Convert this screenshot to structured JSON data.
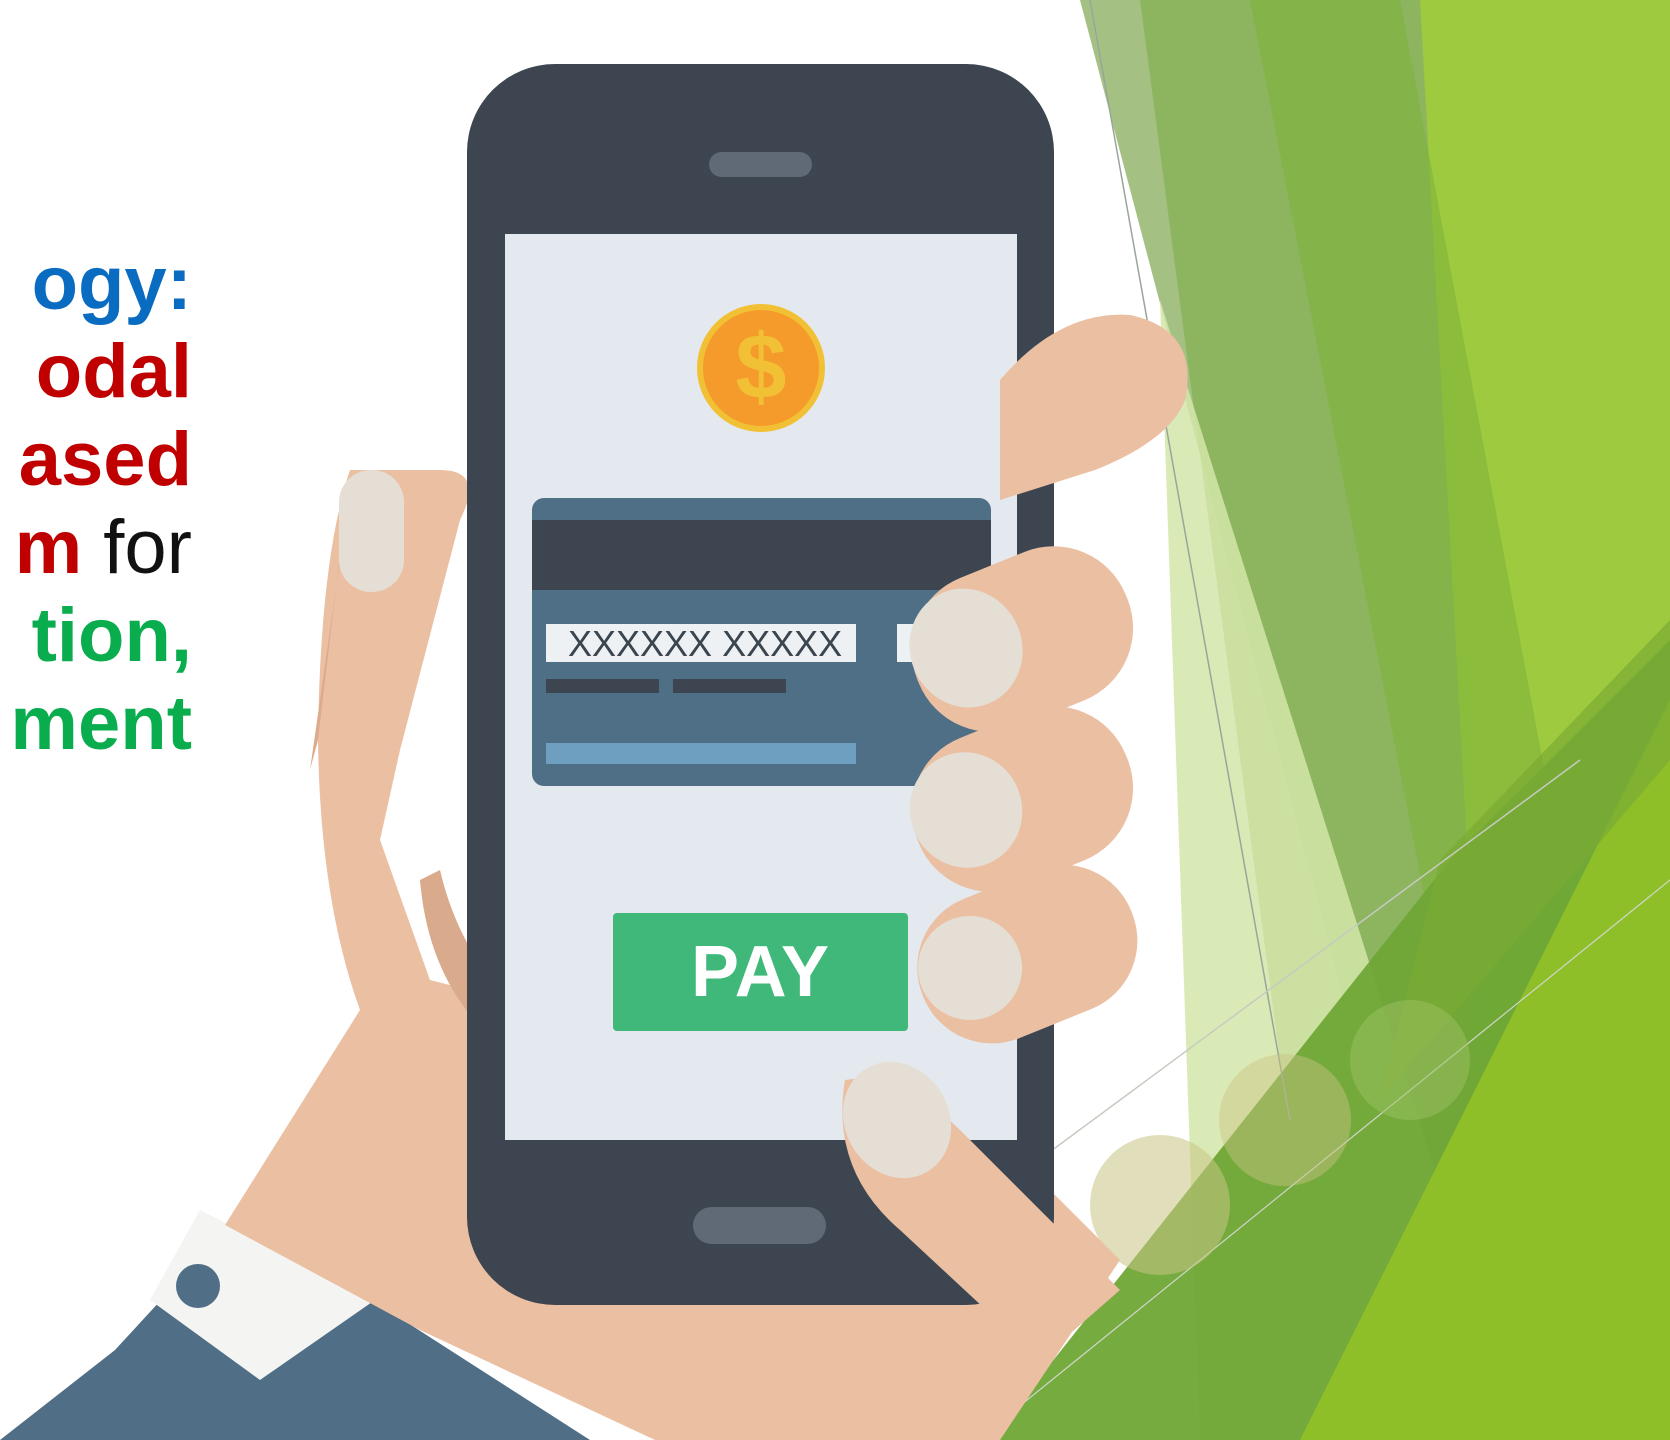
{
  "headline": {
    "line1": "ogy:",
    "line2": "odal",
    "line3": "ased",
    "line4_bold": "m",
    "line4_tail": " for",
    "line5": "tion,",
    "line6": "ment"
  },
  "phone": {
    "card_number": "XXXXXX XXXXX",
    "pay_label": "PAY",
    "coin_symbol": "$"
  },
  "icons": [
    "dollar-coin-icon",
    "credit-card-icon"
  ],
  "colors": {
    "blue": "#0a6cc0",
    "red": "#c00000",
    "green": "#0aad4e",
    "black": "#111111",
    "pay_button": "#3fb87a",
    "phone_body": "#3d4650",
    "phone_screen": "#e3e9ee",
    "skin": "#ebbfa2",
    "nail": "#e5ded4",
    "sleeve": "#506e86",
    "cuff": "#f4f4f2",
    "coin": "#f49b2c",
    "card": "#4f6f87",
    "leaf_light": "#9bc24c",
    "leaf_dark": "#6aa22e"
  }
}
